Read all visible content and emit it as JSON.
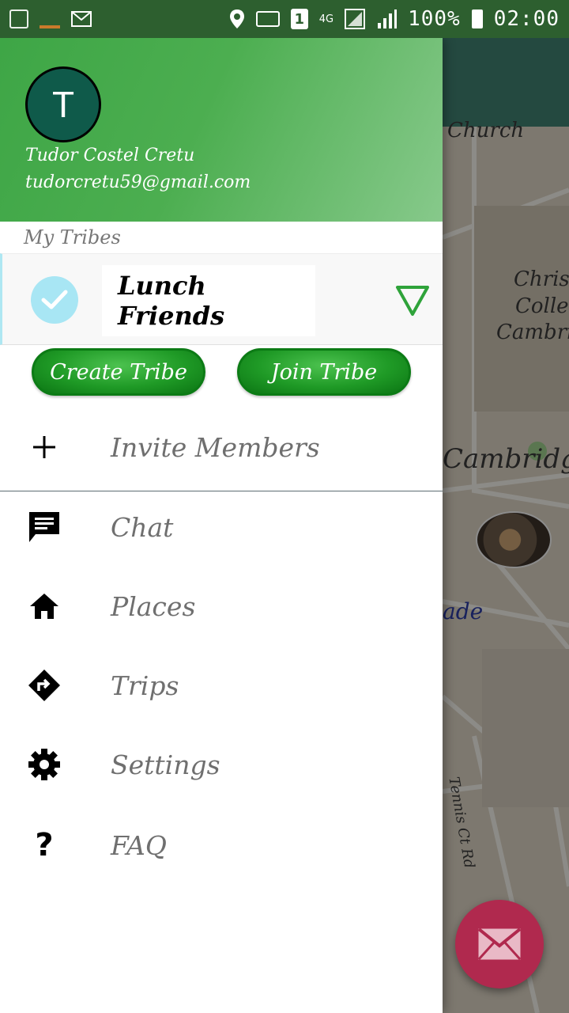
{
  "status_bar": {
    "battery": "100%",
    "time": "02:00",
    "network": "4G",
    "sim_slot": "1"
  },
  "drawer": {
    "profile": {
      "initial": "T",
      "name": "Tudor Costel Cretu",
      "email": "tudorcretu59@gmail.com"
    },
    "tribes_label": "My Tribes",
    "selected_tribe": "Lunch Friends",
    "buttons": {
      "create": "Create Tribe",
      "join": "Join Tribe"
    },
    "invite_label": "Invite Members",
    "menu": [
      {
        "label": "Chat",
        "icon": "chat-icon"
      },
      {
        "label": "Places",
        "icon": "home-icon"
      },
      {
        "label": "Trips",
        "icon": "directions-icon"
      },
      {
        "label": "Settings",
        "icon": "gear-icon"
      },
      {
        "label": "FAQ",
        "icon": "question-icon"
      }
    ]
  },
  "map": {
    "labels": [
      "Church",
      "Christ",
      "Colleg",
      "Cambri",
      "Cambridge",
      "ade",
      "Tennis Ct Rd"
    ]
  },
  "colors": {
    "header_green": "#4cae50",
    "button_green": "#1f9a26",
    "fab": "#b0294e",
    "check_circle": "#a8e6f4"
  }
}
